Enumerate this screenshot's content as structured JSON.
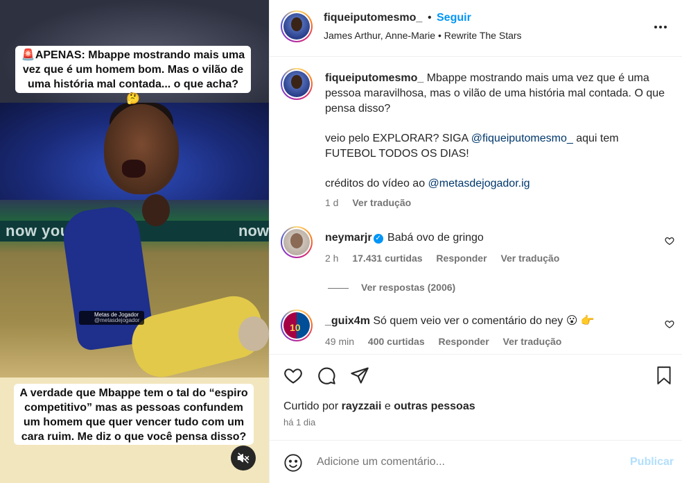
{
  "media": {
    "caption_top": "🚨APENAS: Mbappe mostrando mais uma vez que é um homem bom. Mas o vilão de uma história mal contada... o que acha? 🤔",
    "caption_bottom": "A verdade que Mbappe tem o tal do “espiro competitivo” mas as pessoas confundem um homem que quer vencer tudo com um cara ruim. Me diz o que você pensa disso?",
    "banner_text_left": "now you c",
    "banner_text_right": "now",
    "watermark_line1": "Metas de Jogador",
    "watermark_line2": "@metasdejogador",
    "mute_icon": "speaker-muted-icon"
  },
  "header": {
    "username": "fiqueiputomesmo_",
    "separator": "•",
    "follow_label": "Seguir",
    "music": "James Arthur, Anne-Marie • Rewrite The Stars",
    "more_label": "..."
  },
  "caption": {
    "username": "fiqueiputomesmo_",
    "text1": "Mbappe mostrando mais uma vez que é uma pessoa maravilhosa, mas o vilão de uma história mal contada. O que pensa disso?",
    "text2_prefix": "veio pelo EXPLORAR? SIGA",
    "text2_mention": "@fiqueiputomesmo_",
    "text2_suffix": "aqui tem FUTEBOL TODOS OS DIAS!",
    "text3_prefix": "créditos do vídeo ao",
    "text3_mention": "@metasdejogador.ig",
    "time": "1 d",
    "translate": "Ver tradução"
  },
  "comments": [
    {
      "username": "neymarjr",
      "verified": true,
      "text": "Babá ovo de gringo",
      "time": "2 h",
      "likes": "17.431 curtidas",
      "reply": "Responder",
      "translate": "Ver tradução"
    },
    {
      "username": "_guix4m",
      "verified": false,
      "text": "Só quem veio ver o comentário do ney 😮 👉",
      "time": "49 min",
      "likes": "400 curtidas",
      "reply": "Responder",
      "translate": "Ver tradução"
    }
  ],
  "replies_label": "Ver respostas (2006)",
  "likes": {
    "prefix": "Curtido por",
    "user": "rayzzaii",
    "connector": "e",
    "others": "outras pessoas"
  },
  "time_ago": "há 1 dia",
  "comment_box": {
    "placeholder": "Adicione um comentário...",
    "publish_label": "Publicar"
  },
  "colors": {
    "accent": "#0095f6",
    "publish_disabled": "#b2dffc",
    "mention": "#00376b",
    "muted_text": "#737373"
  }
}
